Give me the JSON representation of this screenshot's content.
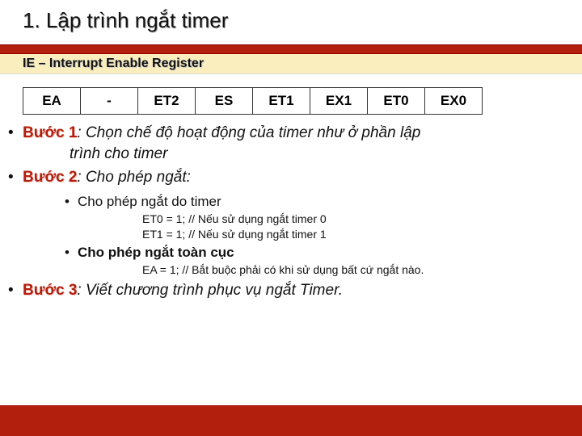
{
  "title": "1. Lập trình ngắt timer",
  "subtitle": "IE – Interrupt Enable Register",
  "register": {
    "cells": [
      "EA",
      "-",
      "ET2",
      "ES",
      "ET1",
      "EX1",
      "ET0",
      "EX0"
    ]
  },
  "steps": {
    "s1": {
      "label": "Bước 1",
      "rest": ": Chọn chế độ hoạt động của timer như ở phần lập",
      "cont": "trình cho timer"
    },
    "s2": {
      "label": "Bước 2",
      "rest": ": Cho phép ngắt:",
      "sub1": {
        "title": "Cho phép ngắt do timer",
        "code1": "ET0 = 1; // Nếu sử dụng ngắt timer 0",
        "code2": "ET1 = 1; // Nếu sử dụng ngắt timer 1"
      },
      "sub2": {
        "title": "Cho phép ngắt toàn cục",
        "code1": "EA = 1; // Bắt buộc phải có khi sử dụng bất cứ ngắt nào."
      }
    },
    "s3": {
      "label": "Bước 3",
      "rest": ": Viết chương trình phục vụ ngắt Timer."
    }
  }
}
